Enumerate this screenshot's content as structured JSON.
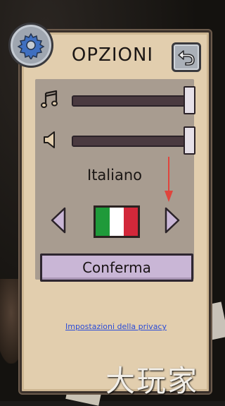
{
  "header": {
    "title": "OPZIONI"
  },
  "icons": {
    "settings": "gear-icon",
    "back": "back-arrow-icon",
    "music": "music-note-icon",
    "sound": "speaker-icon",
    "prev_language": "chevron-left-icon",
    "next_language": "chevron-right-icon"
  },
  "settings": {
    "music_volume": 1.0,
    "sound_volume": 1.0,
    "language": "Italiano",
    "flag_colors": [
      "#1f9a3a",
      "#ffffff",
      "#d2283a"
    ]
  },
  "actions": {
    "confirm_label": "Conferma",
    "privacy_link": "Impostazioni della privacy"
  },
  "watermark": {
    "text": "大玩家"
  },
  "colors": {
    "panel": "#e2ceae",
    "inner_panel": "#a89c90",
    "confirm_button": "#c9b6d6",
    "link": "#2a4bd8",
    "annotation_arrow": "#e0443c"
  }
}
